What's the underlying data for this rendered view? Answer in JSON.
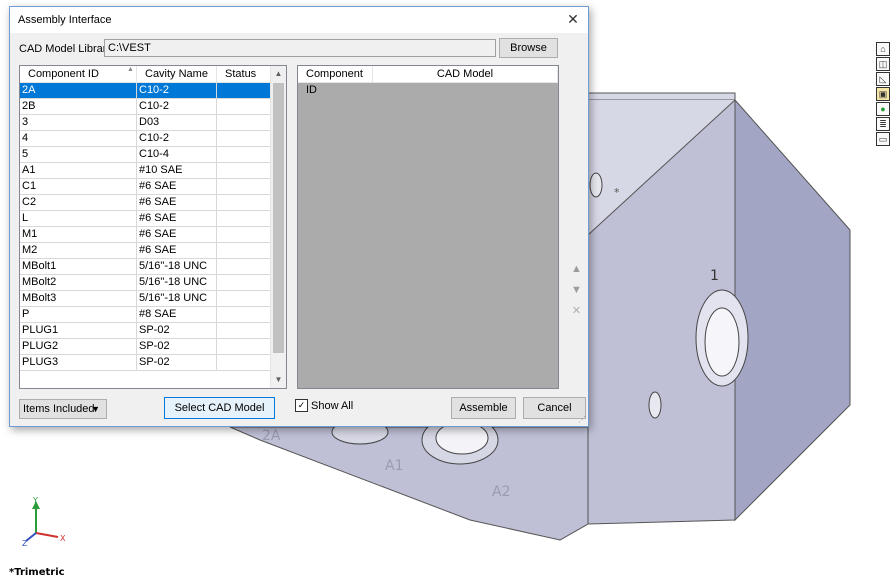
{
  "viewport": {
    "view_label": "*Trimetric",
    "part_labels": [
      "1",
      "A1",
      "A2",
      "2A",
      "*"
    ],
    "triad": {
      "x_label": "X",
      "y_label": "Y",
      "z_label": "Z"
    },
    "toolbar_icons": [
      "home-icon",
      "view-cube-icon",
      "sketch-icon",
      "display-icon",
      "appearance-icon",
      "scene-icon",
      "comment-icon"
    ]
  },
  "dialog": {
    "title": "Assembly Interface",
    "close_glyph": "✕",
    "library_label": "CAD Model Library",
    "library_path": "C:\\VEST",
    "browse_label": "Browse",
    "left_grid": {
      "columns": [
        "Component ID",
        "Cavity Name",
        "Status"
      ],
      "rows": [
        {
          "id": "2A",
          "cavity": "C10-2",
          "status": "",
          "selected": true
        },
        {
          "id": "2B",
          "cavity": "C10-2",
          "status": ""
        },
        {
          "id": "3",
          "cavity": "D03",
          "status": ""
        },
        {
          "id": "4",
          "cavity": "C10-2",
          "status": ""
        },
        {
          "id": "5",
          "cavity": "C10-4",
          "status": ""
        },
        {
          "id": "A1",
          "cavity": "#10 SAE",
          "status": ""
        },
        {
          "id": "C1",
          "cavity": "#6 SAE",
          "status": ""
        },
        {
          "id": "C2",
          "cavity": "#6 SAE",
          "status": ""
        },
        {
          "id": "L",
          "cavity": "#6 SAE",
          "status": ""
        },
        {
          "id": "M1",
          "cavity": "#6 SAE",
          "status": ""
        },
        {
          "id": "M2",
          "cavity": "#6 SAE",
          "status": ""
        },
        {
          "id": "MBolt1",
          "cavity": "5/16\"-18 UNC",
          "status": ""
        },
        {
          "id": "MBolt2",
          "cavity": "5/16\"-18 UNC",
          "status": ""
        },
        {
          "id": "MBolt3",
          "cavity": "5/16\"-18 UNC",
          "status": ""
        },
        {
          "id": "P",
          "cavity": "#8 SAE",
          "status": ""
        },
        {
          "id": "PLUG1",
          "cavity": "SP-02",
          "status": ""
        },
        {
          "id": "PLUG2",
          "cavity": "SP-02",
          "status": ""
        },
        {
          "id": "PLUG3",
          "cavity": "SP-02",
          "status": ""
        }
      ]
    },
    "right_grid": {
      "columns": [
        "Component ID",
        "CAD Model"
      ]
    },
    "movers": {
      "up": "▲",
      "down": "▼",
      "remove": "✕"
    },
    "items_included_label": "Items Included",
    "select_cad_label": "Select CAD Model",
    "show_all_label": "Show All",
    "show_all_checked": true,
    "assemble_label": "Assemble",
    "cancel_label": "Cancel"
  },
  "colors": {
    "selection": "#0078d7",
    "part_top": "#d7d8e6",
    "part_front": "#bfc0d6",
    "part_side": "#a3a5c4"
  }
}
